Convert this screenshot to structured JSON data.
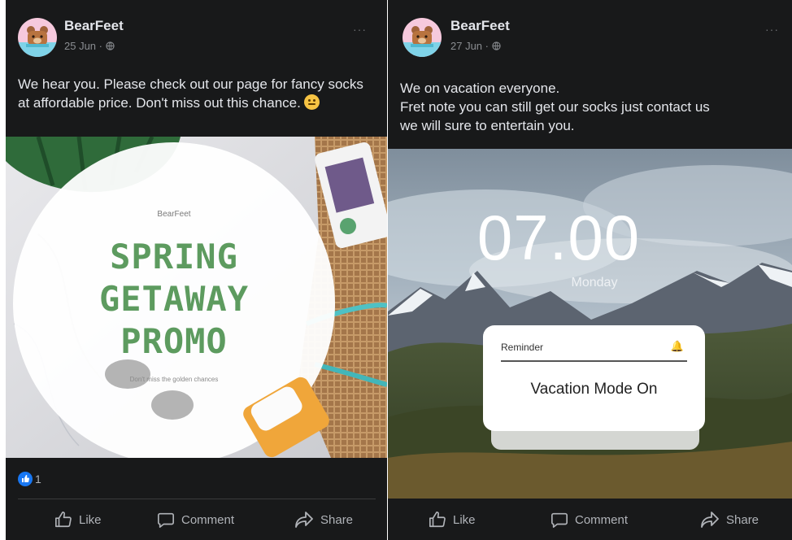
{
  "posts": [
    {
      "page_name": "BearFeet",
      "date": "25 Jun · ",
      "caption": "We hear you. Please check out our page for fancy socks at affordable price. Don't miss out this chance.",
      "image": {
        "brand": "BearFeet",
        "headline": [
          "SPRING",
          "GETAWAY",
          "PROMO"
        ],
        "tagline": "Don't miss the golden chances"
      },
      "reaction_count": "1",
      "actions": {
        "like": "Like",
        "comment": "Comment",
        "share": "Share"
      }
    },
    {
      "page_name": "BearFeet",
      "date": "27 Jun · ",
      "caption_lines": [
        "We on vacation everyone.",
        "Fret note you can still get our socks just contact us",
        "we will sure to entertain you."
      ],
      "image": {
        "time": "07.00",
        "day": "Monday",
        "reminder_title": "Reminder",
        "reminder_text": "Vacation Mode On"
      },
      "actions": {
        "like": "Like",
        "comment": "Comment",
        "share": "Share"
      }
    }
  ],
  "colors": {
    "background": "#18191a",
    "text": "#e4e6eb",
    "muted": "#b0b3b8",
    "promo_green": "#5d9b5f",
    "like_blue": "#1877f2"
  },
  "icons": [
    "globe-icon",
    "more-options-icon",
    "like-icon",
    "comment-icon",
    "share-icon",
    "bell-icon",
    "like-reaction-icon"
  ]
}
